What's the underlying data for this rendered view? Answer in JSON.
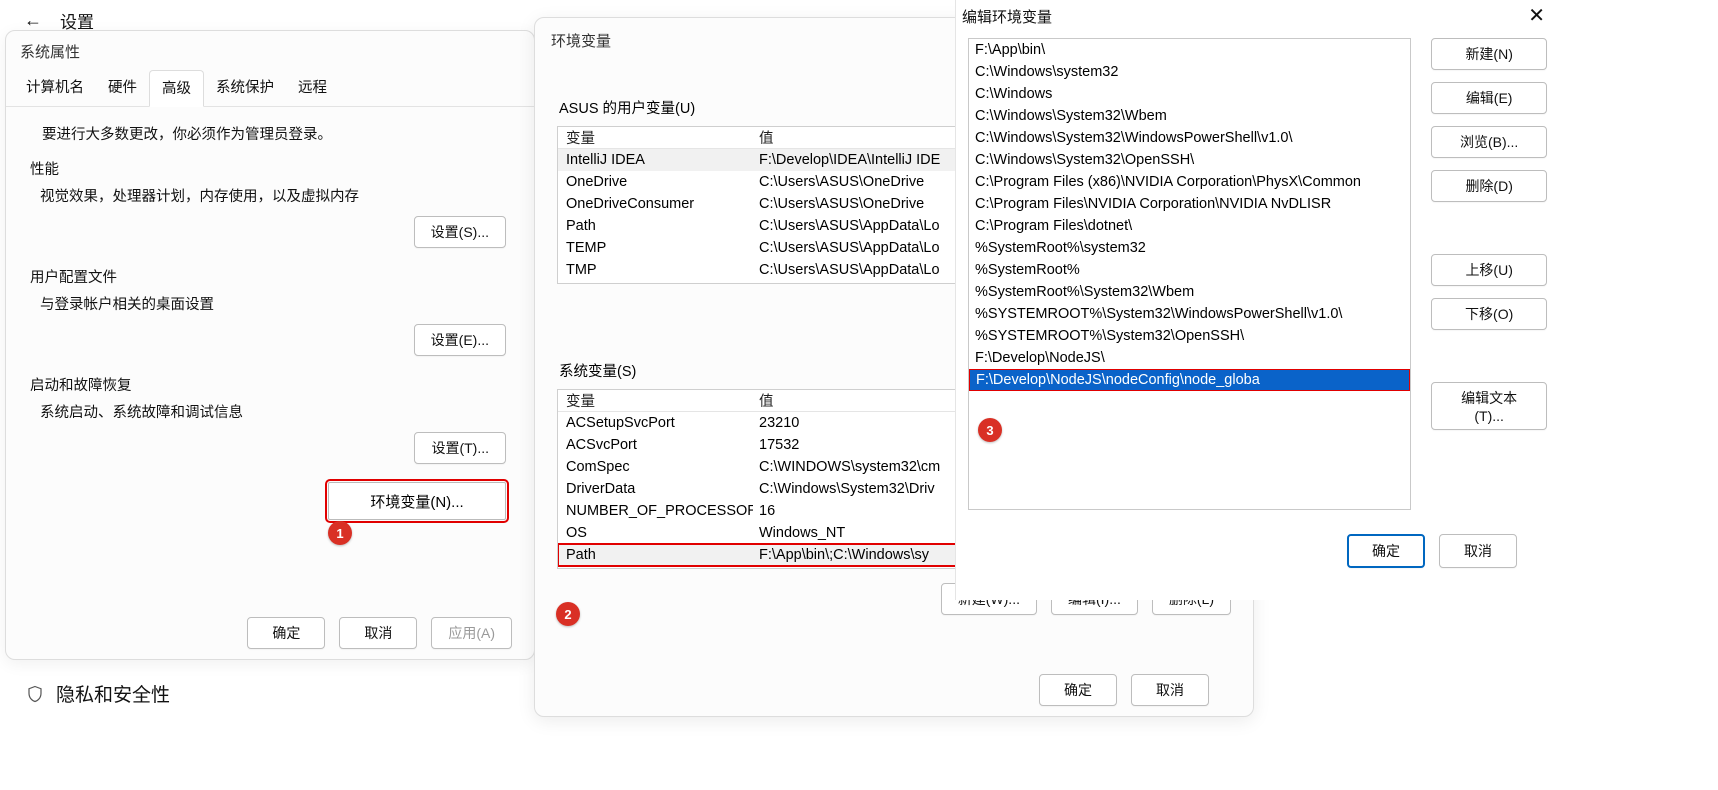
{
  "settings": {
    "title": "设置",
    "privacy": "隐私和安全性"
  },
  "sysprop": {
    "title": "系统属性",
    "tabs": [
      "计算机名",
      "硬件",
      "高级",
      "系统保护",
      "远程"
    ],
    "active_tab_index": 2,
    "admin_note": "要进行大多数更改，你必须作为管理员登录。",
    "perf": {
      "title": "性能",
      "desc": "视觉效果，处理器计划，内存使用，以及虚拟内存",
      "btn": "设置(S)..."
    },
    "profile": {
      "title": "用户配置文件",
      "desc": "与登录帐户相关的桌面设置",
      "btn": "设置(E)..."
    },
    "startup": {
      "title": "启动和故障恢复",
      "desc": "系统启动、系统故障和调试信息",
      "btn": "设置(T)..."
    },
    "env_btn": "环境变量(N)...",
    "ok": "确定",
    "cancel": "取消",
    "apply": "应用(A)"
  },
  "envdlg": {
    "title": "环境变量",
    "user_section": "ASUS 的用户变量(U)",
    "sys_section": "系统变量(S)",
    "col_name": "变量",
    "col_val": "值",
    "user_vars": [
      {
        "name": "IntelliJ IDEA",
        "value": "F:\\Develop\\IDEA\\IntelliJ IDE"
      },
      {
        "name": "OneDrive",
        "value": "C:\\Users\\ASUS\\OneDrive"
      },
      {
        "name": "OneDriveConsumer",
        "value": "C:\\Users\\ASUS\\OneDrive"
      },
      {
        "name": "Path",
        "value": "C:\\Users\\ASUS\\AppData\\Lo"
      },
      {
        "name": "TEMP",
        "value": "C:\\Users\\ASUS\\AppData\\Lo"
      },
      {
        "name": "TMP",
        "value": "C:\\Users\\ASUS\\AppData\\Lo"
      }
    ],
    "sys_vars": [
      {
        "name": "ACSetupSvcPort",
        "value": "23210"
      },
      {
        "name": "ACSvcPort",
        "value": "17532"
      },
      {
        "name": "ComSpec",
        "value": "C:\\WINDOWS\\system32\\cm"
      },
      {
        "name": "DriverData",
        "value": "C:\\Windows\\System32\\Driv"
      },
      {
        "name": "NUMBER_OF_PROCESSORS",
        "value": "16"
      },
      {
        "name": "OS",
        "value": "Windows_NT"
      },
      {
        "name": "Path",
        "value": "F:\\App\\bin\\;C:\\Windows\\sy"
      }
    ],
    "new_btn_cut": "新建",
    "new_btn": "新建(W)...",
    "edit_btn": "编辑(I)...",
    "del_btn": "删除(L)",
    "ok": "确定",
    "cancel": "取消"
  },
  "editdlg": {
    "title": "编辑环境变量",
    "paths": [
      "F:\\App\\bin\\",
      "C:\\Windows\\system32",
      "C:\\Windows",
      "C:\\Windows\\System32\\Wbem",
      "C:\\Windows\\System32\\WindowsPowerShell\\v1.0\\",
      "C:\\Windows\\System32\\OpenSSH\\",
      "C:\\Program Files (x86)\\NVIDIA Corporation\\PhysX\\Common",
      "C:\\Program Files\\NVIDIA Corporation\\NVIDIA NvDLISR",
      "C:\\Program Files\\dotnet\\",
      "%SystemRoot%\\system32",
      "%SystemRoot%",
      "%SystemRoot%\\System32\\Wbem",
      "%SYSTEMROOT%\\System32\\WindowsPowerShell\\v1.0\\",
      "%SYSTEMROOT%\\System32\\OpenSSH\\",
      "F:\\Develop\\NodeJS\\",
      "F:\\Develop\\NodeJS\\nodeConfig\\node_globa"
    ],
    "selected_index": 15,
    "btn_new": "新建(N)",
    "btn_edit": "编辑(E)",
    "btn_browse": "浏览(B)...",
    "btn_delete": "删除(D)",
    "btn_up": "上移(U)",
    "btn_down": "下移(O)",
    "btn_edittext": "编辑文本(T)...",
    "ok": "确定",
    "cancel": "取消"
  },
  "steps": {
    "s1": "1",
    "s2": "2",
    "s3": "3"
  }
}
